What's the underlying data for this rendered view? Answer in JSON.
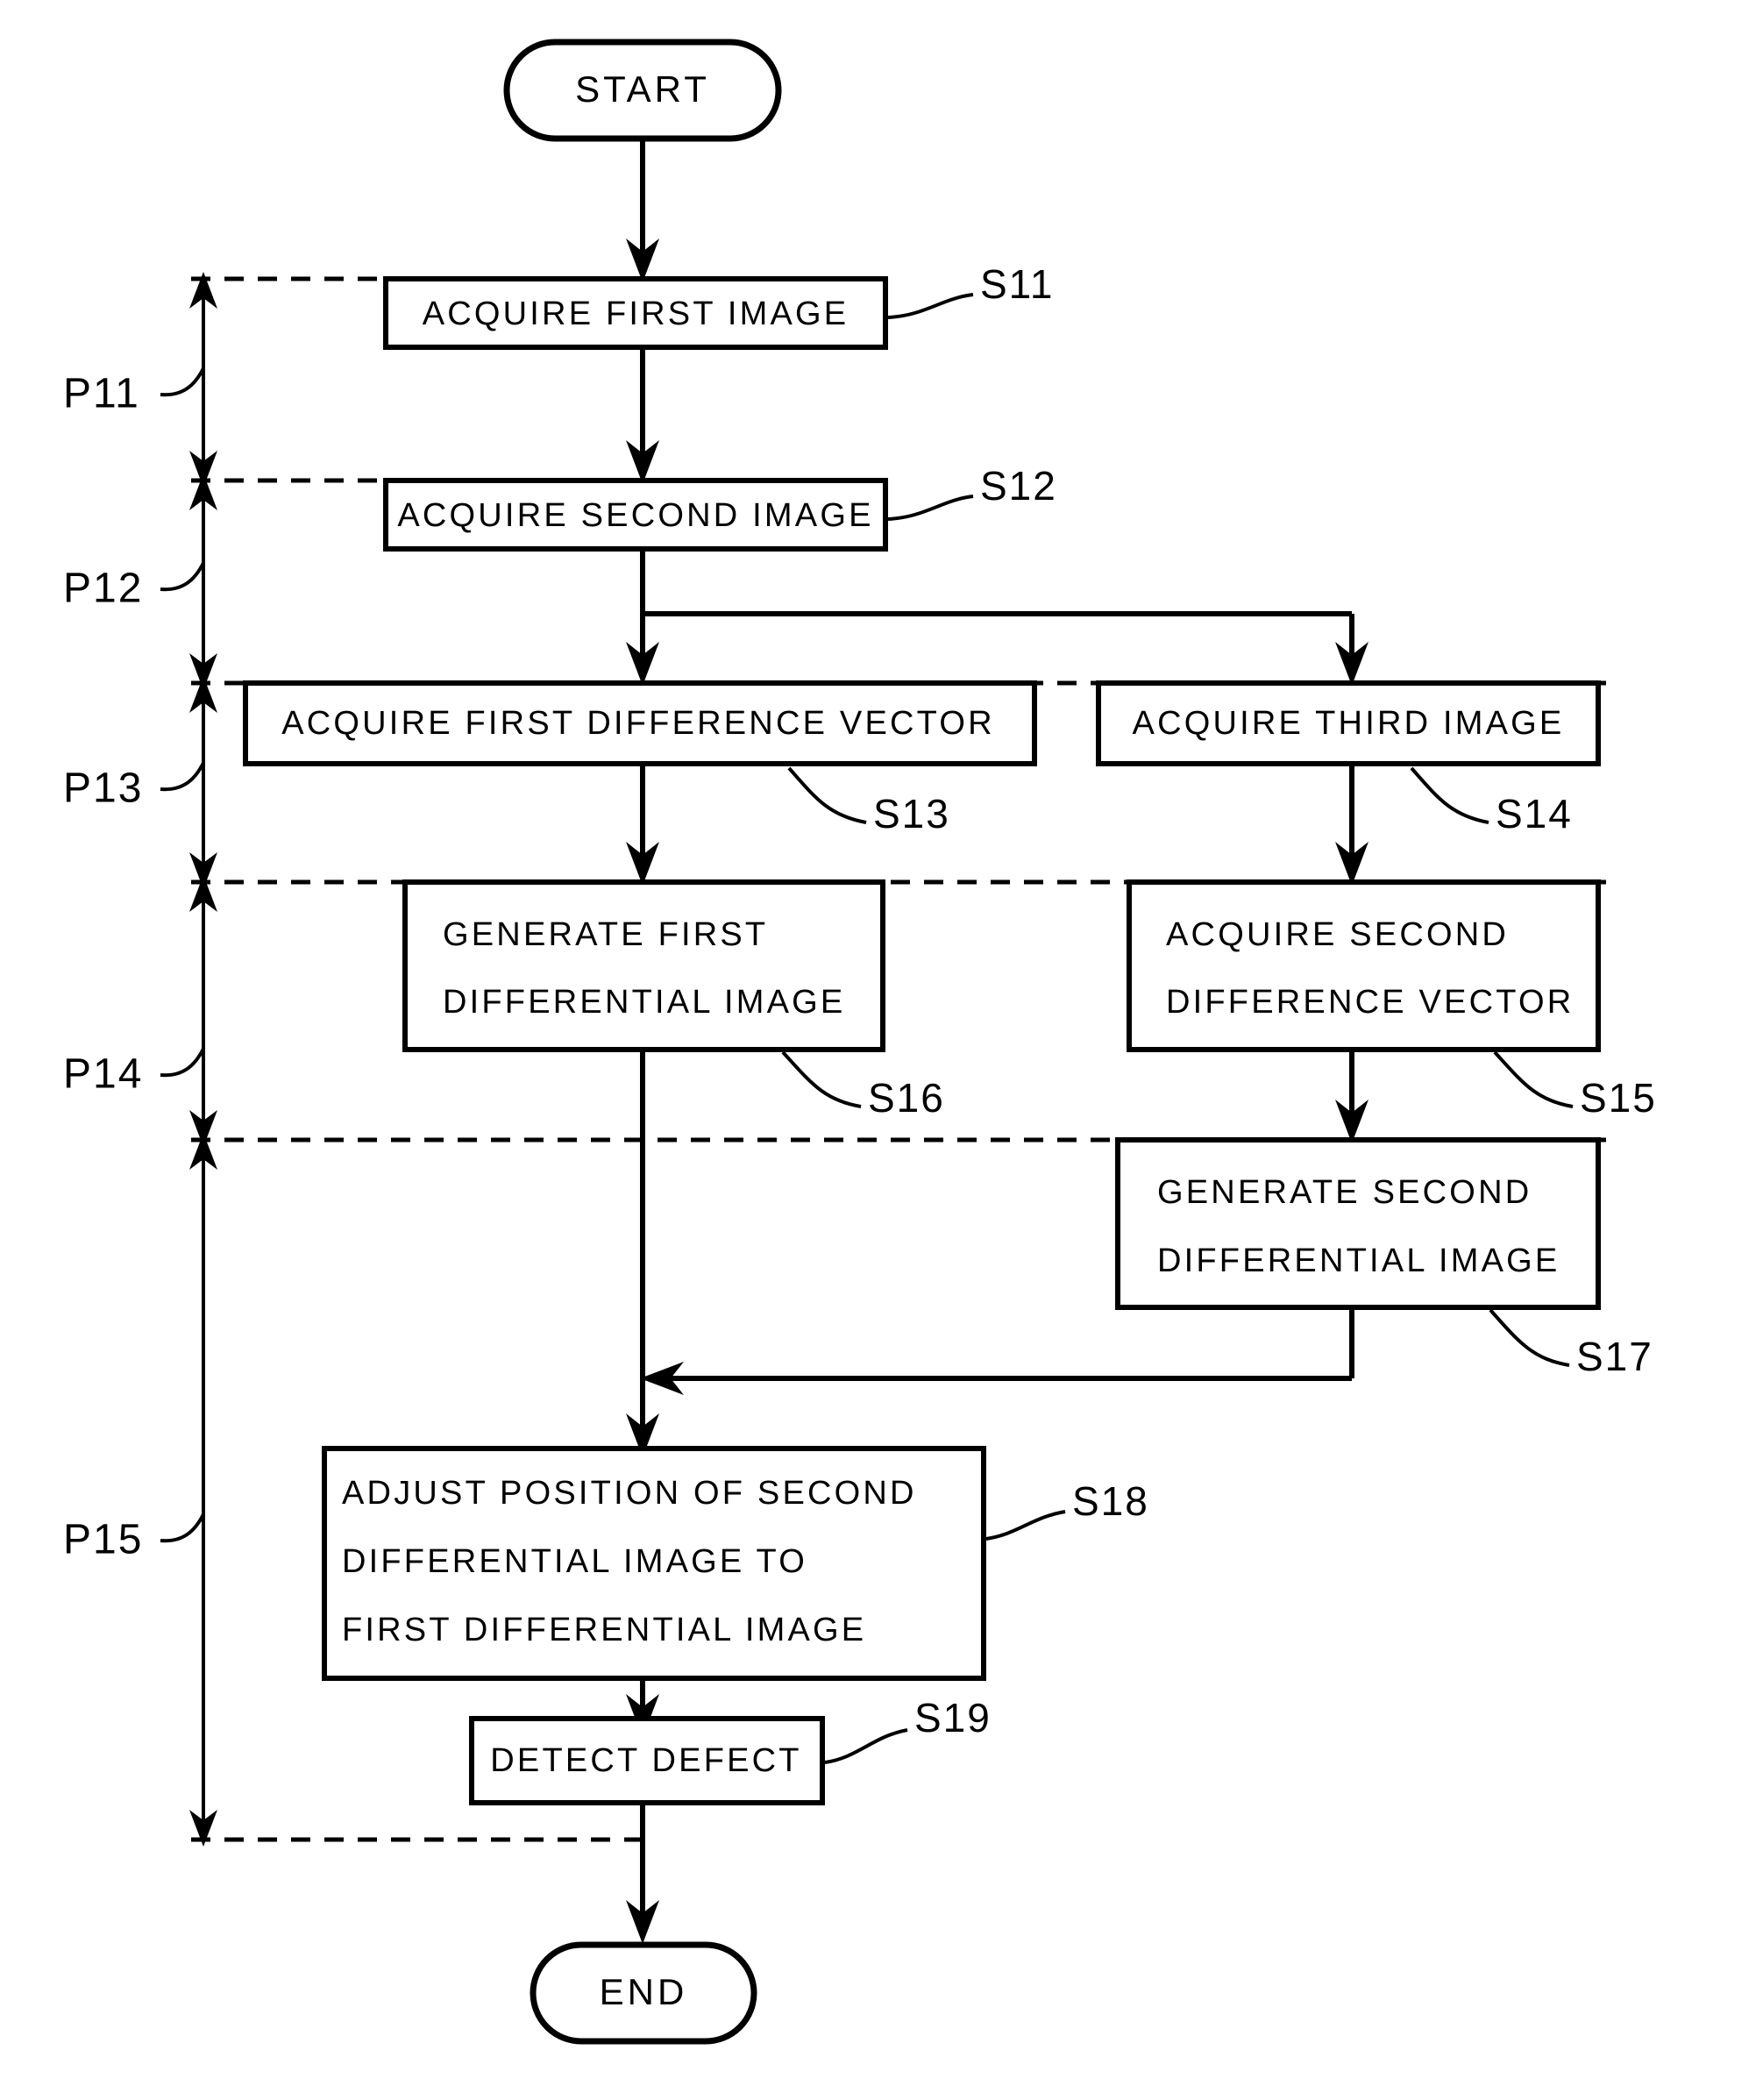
{
  "figure": {
    "type": "flowchart",
    "orientation": "vertical",
    "background_color": "#ffffff",
    "line_color": "#000000"
  },
  "terminals": {
    "start": "START",
    "end": "END"
  },
  "steps": [
    {
      "id": "S11",
      "ref": "S11",
      "lines": [
        "ACQUIRE FIRST IMAGE"
      ],
      "column": "left"
    },
    {
      "id": "S12",
      "ref": "S12",
      "lines": [
        "ACQUIRE SECOND IMAGE"
      ],
      "column": "left"
    },
    {
      "id": "S13",
      "ref": "S13",
      "lines": [
        "ACQUIRE FIRST DIFFERENCE VECTOR"
      ],
      "column": "left"
    },
    {
      "id": "S14",
      "ref": "S14",
      "lines": [
        "ACQUIRE THIRD IMAGE"
      ],
      "column": "right"
    },
    {
      "id": "S16",
      "ref": "S16",
      "lines": [
        "GENERATE FIRST",
        "DIFFERENTIAL IMAGE"
      ],
      "column": "left"
    },
    {
      "id": "S15",
      "ref": "S15",
      "lines": [
        "ACQUIRE SECOND",
        "DIFFERENCE VECTOR"
      ],
      "column": "right"
    },
    {
      "id": "S17",
      "ref": "S17",
      "lines": [
        "GENERATE SECOND",
        "DIFFERENTIAL IMAGE"
      ],
      "column": "right"
    },
    {
      "id": "S18",
      "ref": "S18",
      "lines": [
        "ADJUST POSITION OF SECOND",
        "DIFFERENTIAL IMAGE TO",
        "FIRST DIFFERENTIAL IMAGE"
      ],
      "column": "left"
    },
    {
      "id": "S19",
      "ref": "S19",
      "lines": [
        "DETECT DEFECT"
      ],
      "column": "left"
    }
  ],
  "phases": [
    {
      "id": "P11",
      "label": "P11"
    },
    {
      "id": "P12",
      "label": "P12"
    },
    {
      "id": "P13",
      "label": "P13"
    },
    {
      "id": "P14",
      "label": "P14"
    },
    {
      "id": "P15",
      "label": "P15"
    }
  ],
  "step_labels": {
    "s11": "S11",
    "s12": "S12",
    "s13": "S13",
    "s14": "S14",
    "s15": "S15",
    "s16": "S16",
    "s17": "S17",
    "s18": "S18",
    "s19": "S19"
  },
  "box_text": {
    "s11_l1": "ACQUIRE FIRST IMAGE",
    "s12_l1": "ACQUIRE SECOND IMAGE",
    "s13_l1": "ACQUIRE FIRST DIFFERENCE VECTOR",
    "s14_l1": "ACQUIRE THIRD IMAGE",
    "s16_l1": "GENERATE FIRST",
    "s16_l2": "DIFFERENTIAL IMAGE",
    "s15_l1": "ACQUIRE SECOND",
    "s15_l2": "DIFFERENCE VECTOR",
    "s17_l1": "GENERATE SECOND",
    "s17_l2": "DIFFERENTIAL IMAGE",
    "s18_l1": "ADJUST POSITION OF SECOND",
    "s18_l2": "DIFFERENTIAL IMAGE TO",
    "s18_l3": "FIRST DIFFERENTIAL IMAGE",
    "s19_l1": "DETECT DEFECT"
  },
  "phase_labels": {
    "p11": "P11",
    "p12": "P12",
    "p13": "P13",
    "p14": "P14",
    "p15": "P15"
  }
}
